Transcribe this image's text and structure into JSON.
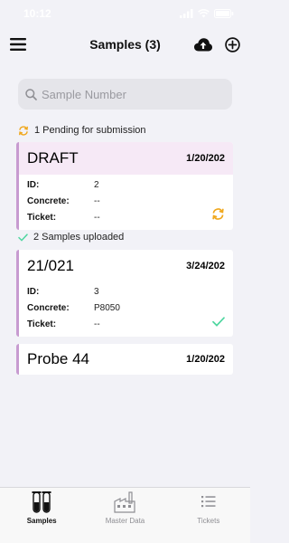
{
  "status_bar": {
    "time": "10:12"
  },
  "header": {
    "title": "Samples (3)"
  },
  "search": {
    "placeholder": "Sample Number"
  },
  "pending": {
    "label": "1 Pending for submission"
  },
  "uploaded": {
    "label": "2 Samples uploaded"
  },
  "cards": [
    {
      "title": "DRAFT",
      "date": "1/20/202",
      "status": "pending-sync",
      "fields": [
        {
          "label": "ID:",
          "value": "2"
        },
        {
          "label": "Concrete:",
          "value": "--"
        },
        {
          "label": "Ticket:",
          "value": "--"
        }
      ]
    },
    {
      "title": "21/021",
      "date": "3/24/202",
      "status": "uploaded",
      "fields": [
        {
          "label": "ID:",
          "value": "3"
        },
        {
          "label": "Concrete:",
          "value": "P8050"
        },
        {
          "label": "Ticket:",
          "value": "--"
        }
      ]
    },
    {
      "title": "Probe 44",
      "date": "1/20/202"
    }
  ],
  "tabs": [
    {
      "label": "Samples",
      "icon": "test-tubes-icon",
      "active": true
    },
    {
      "label": "Master Data",
      "icon": "factory-icon",
      "active": false
    },
    {
      "label": "Tickets",
      "icon": "list-icon",
      "active": false
    }
  ],
  "colors": {
    "accent_border": "#c79bd0",
    "draft_header": "#f6e9f6",
    "sync_orange": "#f0a81e",
    "check_green": "#4fd6a0",
    "background": "#f2f2f7"
  }
}
